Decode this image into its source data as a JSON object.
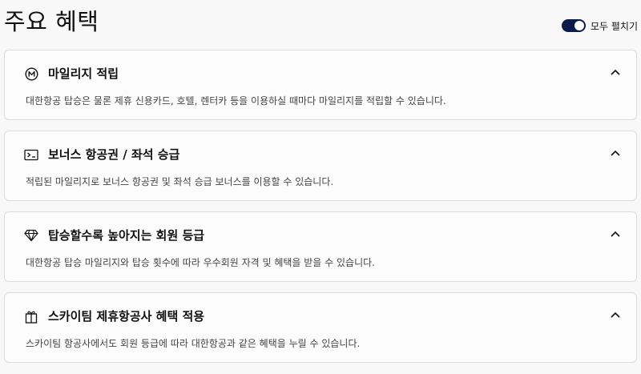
{
  "header": {
    "title": "주요 혜택",
    "toggle": {
      "label": "모두 펼치기",
      "on": true,
      "color": "#0d1b4b"
    }
  },
  "benefits": [
    {
      "icon": "mileage-coin-icon",
      "title": "마일리지 적립",
      "description": "대한항공 탑승은 물론 제휴 신용카드, 호텔, 렌터카 등을 이용하실 때마다 마일리지를 적립할 수 있습니다.",
      "expanded": true
    },
    {
      "icon": "ticket-icon",
      "title": "보너스 항공권 / 좌석 승급",
      "description": "적립된 마일리지로 보너스 항공권 및 좌석 승급 보너스를 이용할 수 있습니다.",
      "expanded": true
    },
    {
      "icon": "diamond-icon",
      "title": "탑승할수록 높아지는 회원 등급",
      "description": "대한항공 탑승 마일리지와 탑승 횟수에 따라 우수회원 자격 및 혜택을 받을 수 있습니다.",
      "expanded": true
    },
    {
      "icon": "gift-icon",
      "title": "스카이팀 제휴항공사 혜택 적용",
      "description": "스카이팀 항공사에서도 회원 등급에 따라 대한항공과 같은 혜택을 누릴 수 있습니다.",
      "expanded": true
    }
  ]
}
